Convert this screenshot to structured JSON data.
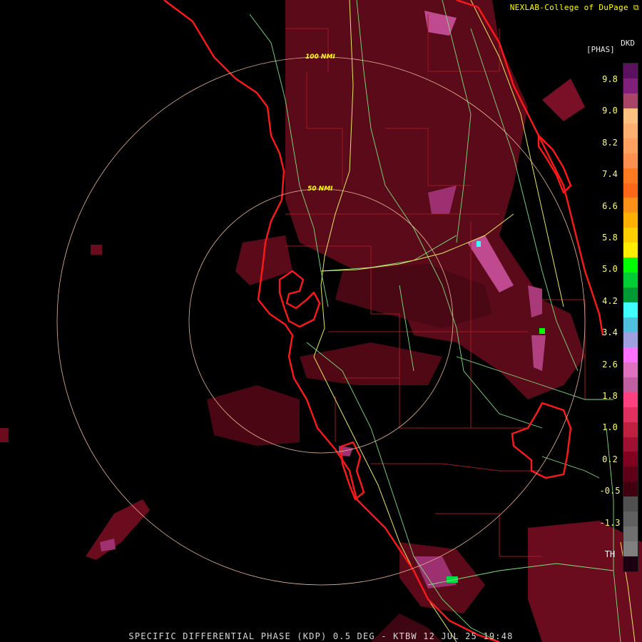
{
  "header": {
    "credit": "NEXLAB-College of DuPage",
    "credit_logo_icon": "cod-logo-icon"
  },
  "footer": {
    "product_line": "SPECIFIC DIFFERENTIAL PHASE (KDP) 0.5 DEG - KTBW 12 JUL 25 19:48"
  },
  "legend": {
    "product_code": "DKD",
    "units": "[PHAS]",
    "ticks": [
      "9.8",
      "9.0",
      "8.2",
      "7.4",
      "6.6",
      "5.8",
      "5.0",
      "4.2",
      "3.4",
      "2.6",
      "1.8",
      "1.0",
      "0.2",
      "-0.5",
      "-1.3",
      "TH"
    ],
    "colors": [
      "#5c1060",
      "#80207a",
      "#a84468",
      "#ffc080",
      "#ffb070",
      "#ffa060",
      "#ff9050",
      "#ff7a20",
      "#ff6818",
      "#ff9018",
      "#ffb000",
      "#ffd000",
      "#ffee00",
      "#00ff00",
      "#00cc33",
      "#009933",
      "#40ffff",
      "#50c0e0",
      "#a0a0e0",
      "#ff70ff",
      "#e070c0",
      "#c060a0",
      "#ff4080",
      "#e03060",
      "#c02040",
      "#a01030",
      "#800020",
      "#600018",
      "#400010",
      "#505050",
      "#606060",
      "#707070",
      "#808080",
      "#1a0010"
    ]
  },
  "map": {
    "range_rings": [
      {
        "label": "100 NMI",
        "radius_nmi": 100
      },
      {
        "label": "50 NMI",
        "radius_nmi": 50
      }
    ]
  }
}
